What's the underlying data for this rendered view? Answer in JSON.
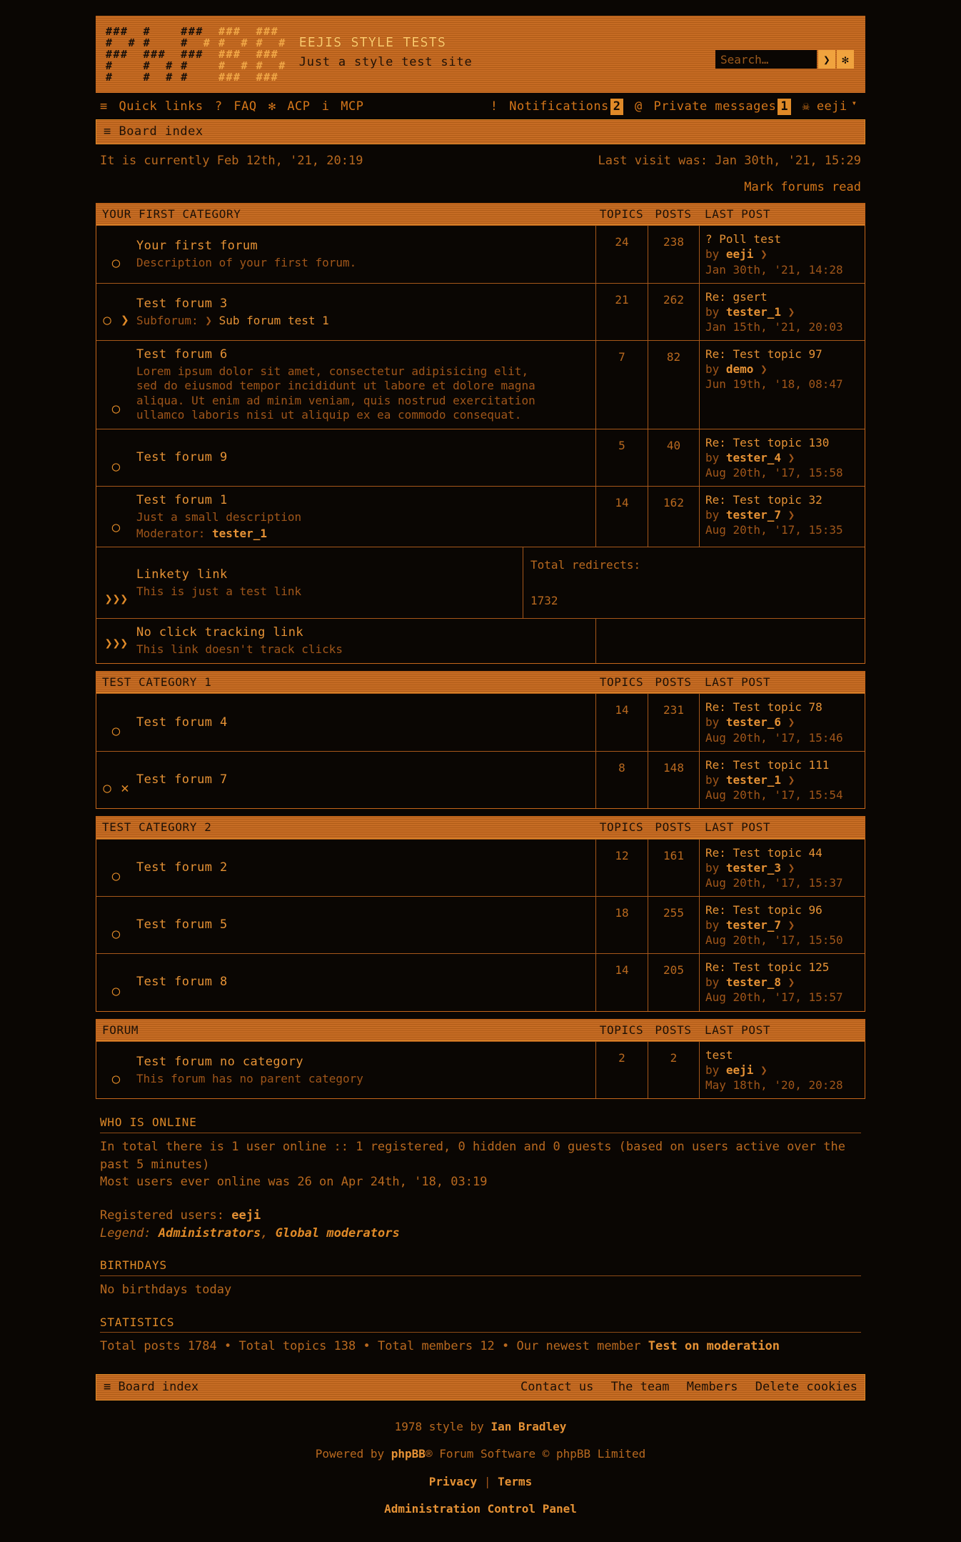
{
  "header": {
    "logo_ascii_rows": [
      "###  #    ###  ###  ###",
      "#  # #    #  # #  # #  #",
      "###  ###  ###  ###  ###",
      "#    #  # #    #  # #  #",
      "#    #  # #    ###  ###"
    ],
    "site_title": "EEJIS STYLE TESTS",
    "site_description": "Just a style test site",
    "search_placeholder": "Search…",
    "search_value": "",
    "search_submit_icon": "❯",
    "search_advanced_icon": "✻"
  },
  "nav": {
    "left": [
      {
        "icon": "≡",
        "label": "Quick links"
      },
      {
        "icon": "?",
        "label": "FAQ"
      },
      {
        "icon": "✻",
        "label": "ACP"
      },
      {
        "icon": "i",
        "label": "MCP"
      }
    ],
    "right": {
      "notifications_icon": "!",
      "notifications_label": "Notifications",
      "notifications_count": "2",
      "pm_icon": "@",
      "pm_label": "Private messages",
      "pm_count": "1",
      "avatar_icon": "☠",
      "username": "eeji",
      "caret_icon": "▾"
    }
  },
  "breadcrumb": {
    "icon": "≡",
    "label": "Board index"
  },
  "timeline": {
    "current_time": "It is currently Feb 12th, '21, 20:19",
    "last_visit": "Last visit was: Jan 30th, '21, 15:29",
    "mark_read": "Mark forums read"
  },
  "columns": {
    "topics": "TOPICS",
    "posts": "POSTS",
    "last_post": "LAST POST"
  },
  "categories": [
    {
      "title": "YOUR FIRST CATEGORY",
      "forums": [
        {
          "type": "forum",
          "icon": "○",
          "name": "Your first forum",
          "desc": "Description of your first forum.",
          "topics": "24",
          "posts": "238",
          "last_title": "? Poll test",
          "last_by_prefix": "by",
          "last_by": "eeji",
          "last_by_arrow": "❯",
          "last_date": "Jan 30th, '21, 14:28"
        },
        {
          "type": "forum",
          "icon": "○ ❯",
          "name": "Test forum 3",
          "subforum_label": "Subforum:",
          "subforum_arrow": "❯",
          "subforum_name": "Sub forum test 1",
          "topics": "21",
          "posts": "262",
          "last_title": "Re: gsert",
          "last_by_prefix": "by",
          "last_by": "tester_1",
          "last_by_arrow": "❯",
          "last_date": "Jan 15th, '21, 20:03"
        },
        {
          "type": "forum",
          "icon": "○",
          "name": "Test forum 6",
          "desc": "Lorem ipsum dolor sit amet, consectetur adipisicing elit, sed do eiusmod tempor incididunt ut labore et dolore magna aliqua. Ut enim ad minim veniam, quis nostrud exercitation ullamco laboris nisi ut aliquip ex ea commodo consequat.",
          "topics": "7",
          "posts": "82",
          "last_title": "Re: Test topic 97",
          "last_by_prefix": "by",
          "last_by": "demo",
          "last_by_arrow": "❯",
          "last_date": "Jun 19th, '18, 08:47"
        },
        {
          "type": "forum",
          "icon": "○",
          "name": "Test forum 9",
          "topics": "5",
          "posts": "40",
          "last_title": "Re: Test topic 130",
          "last_by_prefix": "by",
          "last_by": "tester_4",
          "last_by_arrow": "❯",
          "last_date": "Aug 20th, '17, 15:58"
        },
        {
          "type": "forum",
          "icon": "○",
          "name": "Test forum 1",
          "desc": "Just a small description",
          "moderator_label": "Moderator:",
          "moderator": "tester_1",
          "topics": "14",
          "posts": "162",
          "last_title": "Re: Test topic 32",
          "last_by_prefix": "by",
          "last_by": "tester_7",
          "last_by_arrow": "❯",
          "last_date": "Aug 20th, '17, 15:35"
        },
        {
          "type": "redirect",
          "icon": "❯❯❯",
          "name": "Linkety link",
          "desc": "This is just a test link",
          "redirect_label": "Total redirects:",
          "redirect_count": "1732"
        },
        {
          "type": "redirect_notrack",
          "icon": "❯❯❯",
          "name": "No click tracking link",
          "desc": "This link doesn't track clicks"
        }
      ]
    },
    {
      "title": "TEST CATEGORY 1",
      "forums": [
        {
          "type": "forum",
          "icon": "○",
          "name": "Test forum 4",
          "topics": "14",
          "posts": "231",
          "last_title": "Re: Test topic 78",
          "last_by_prefix": "by",
          "last_by": "tester_6",
          "last_by_arrow": "❯",
          "last_date": "Aug 20th, '17, 15:46"
        },
        {
          "type": "forum",
          "icon": "○ ✕",
          "name": "Test forum 7",
          "topics": "8",
          "posts": "148",
          "last_title": "Re: Test topic 111",
          "last_by_prefix": "by",
          "last_by": "tester_1",
          "last_by_arrow": "❯",
          "last_date": "Aug 20th, '17, 15:54"
        }
      ]
    },
    {
      "title": "TEST CATEGORY 2",
      "forums": [
        {
          "type": "forum",
          "icon": "○",
          "name": "Test forum 2",
          "topics": "12",
          "posts": "161",
          "last_title": "Re: Test topic 44",
          "last_by_prefix": "by",
          "last_by": "tester_3",
          "last_by_arrow": "❯",
          "last_date": "Aug 20th, '17, 15:37"
        },
        {
          "type": "forum",
          "icon": "○",
          "name": "Test forum 5",
          "topics": "18",
          "posts": "255",
          "last_title": "Re: Test topic 96",
          "last_by_prefix": "by",
          "last_by": "tester_7",
          "last_by_arrow": "❯",
          "last_date": "Aug 20th, '17, 15:50"
        },
        {
          "type": "forum",
          "icon": "○",
          "name": "Test forum 8",
          "topics": "14",
          "posts": "205",
          "last_title": "Re: Test topic 125",
          "last_by_prefix": "by",
          "last_by": "tester_8",
          "last_by_arrow": "❯",
          "last_date": "Aug 20th, '17, 15:57"
        }
      ]
    },
    {
      "title": "FORUM",
      "forums": [
        {
          "type": "forum",
          "icon": "○",
          "name": "Test forum no category",
          "desc": "This forum has no parent category",
          "topics": "2",
          "posts": "2",
          "last_title": "test",
          "last_by_prefix": "by",
          "last_by": "eeji",
          "last_by_arrow": "❯",
          "last_date": "May 18th, '20, 20:28"
        }
      ]
    }
  ],
  "who_is_online": {
    "heading": "WHO IS ONLINE",
    "line1": "In total there is 1 user online :: 1 registered, 0 hidden and 0 guests (based on users active over the past 5 minutes)",
    "line2": "Most users ever online was 26 on Apr 24th, '18, 03:19",
    "registered_label": "Registered users:",
    "registered_users": "eeji",
    "legend_label": "Legend:",
    "legend_admins": "Administrators",
    "legend_sep": ",",
    "legend_mods": "Global moderators"
  },
  "birthdays": {
    "heading": "BIRTHDAYS",
    "text": "No birthdays today"
  },
  "statistics": {
    "heading": "STATISTICS",
    "total_posts": "Total posts 1784",
    "bullet1": "•",
    "total_topics": "Total topics 138",
    "bullet2": "•",
    "total_members": "Total members 12",
    "bullet3": "•",
    "newest_label": "Our newest member",
    "newest_member": "Test on moderation"
  },
  "footer": {
    "board_index_icon": "≡",
    "board_index": "Board index",
    "links": [
      "Contact us",
      "The team",
      "Members",
      "Delete cookies"
    ],
    "style_prefix": "1978 style by",
    "style_author": "Ian Bradley",
    "powered_prefix": "Powered by",
    "powered_brand": "phpBB",
    "powered_reg": "®",
    "powered_suffix": "Forum Software © phpBB Limited",
    "privacy": "Privacy",
    "pipe": "|",
    "terms": "Terms",
    "acp": "Administration Control Panel"
  },
  "colors": {
    "background": "#0a0603",
    "accent": "#c4661b",
    "accent_light": "#e08a28",
    "text": "#d4761a",
    "link": "#e69235",
    "muted": "#a0561a"
  }
}
